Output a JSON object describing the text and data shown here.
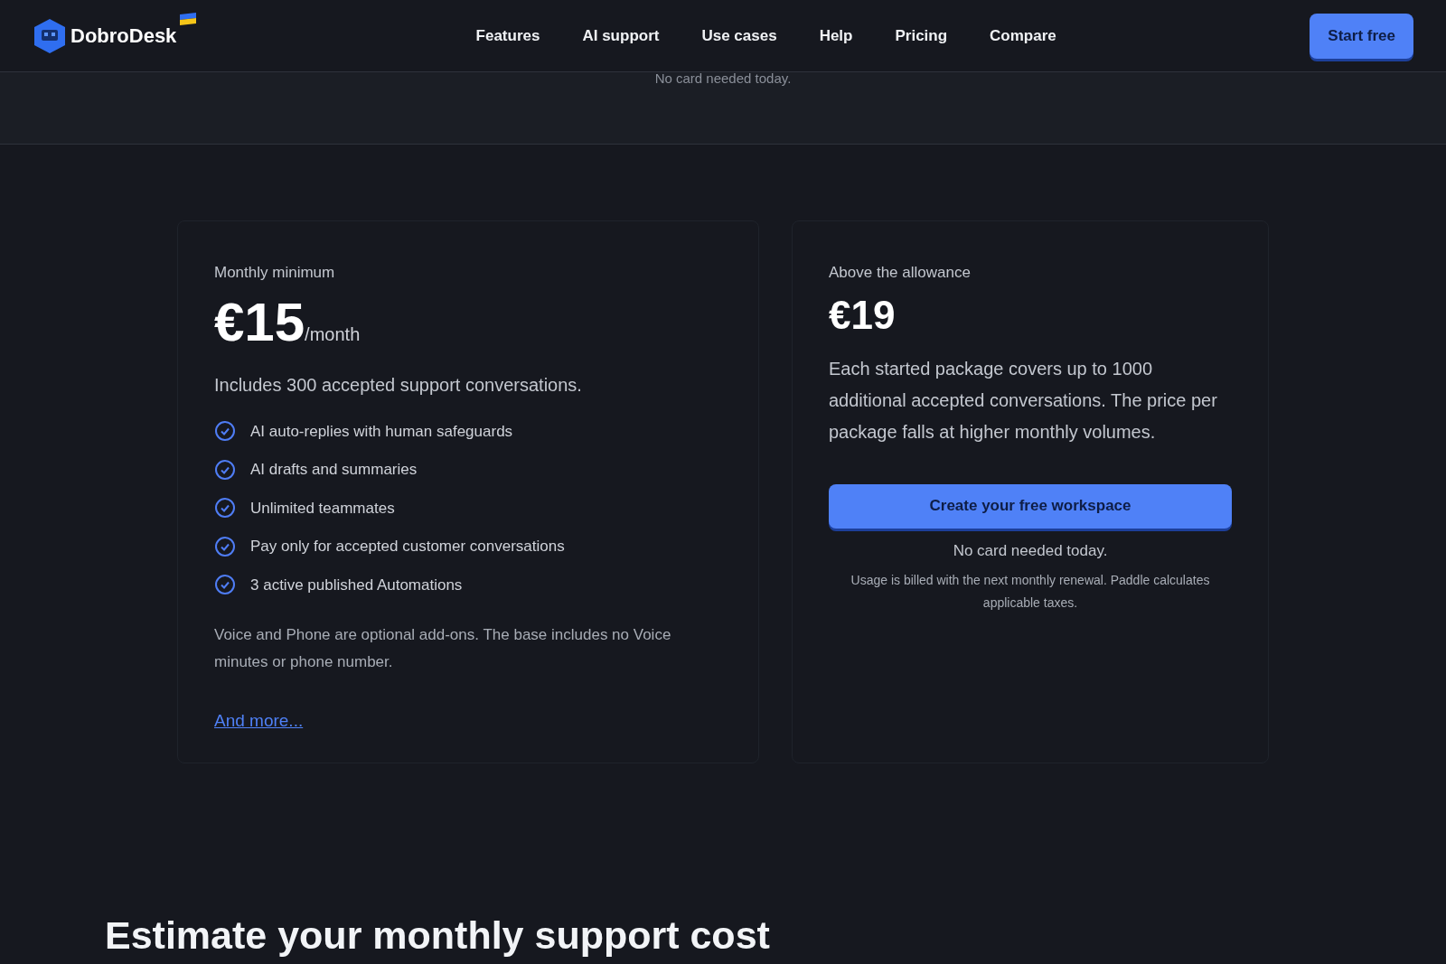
{
  "header": {
    "logo": "DobroDesk",
    "nav": [
      {
        "label": "Features"
      },
      {
        "label": "AI support"
      },
      {
        "label": "Use cases"
      },
      {
        "label": "Help"
      },
      {
        "label": "Pricing"
      },
      {
        "label": "Compare"
      }
    ],
    "cta": "Start free"
  },
  "top_note": "No card needed today.",
  "plans": [
    {
      "label": "Monthly minimum",
      "price": "€15",
      "period": "/month",
      "summary": "Includes 300 accepted support conversations.",
      "features": [
        "AI auto-replies with human safeguards",
        "AI drafts and summaries",
        "Unlimited teammates",
        "Pay only for accepted customer conversations",
        "3 active published Automations"
      ],
      "note": "Voice and Phone are optional add-ons. The base includes no Voice minutes or phone number.",
      "link": "And more..."
    },
    {
      "label": "Above the allowance",
      "price": "€19",
      "summary": "Each started package covers up to 1000 additional accepted conversations. The price per package falls at higher monthly volumes.",
      "button": "Create your free workspace",
      "button_note": "No card needed today.",
      "fine_print": "Usage is billed with the next monthly renewal. Paddle calculates applicable taxes."
    }
  ],
  "estimate_heading": "Estimate your monthly support cost"
}
